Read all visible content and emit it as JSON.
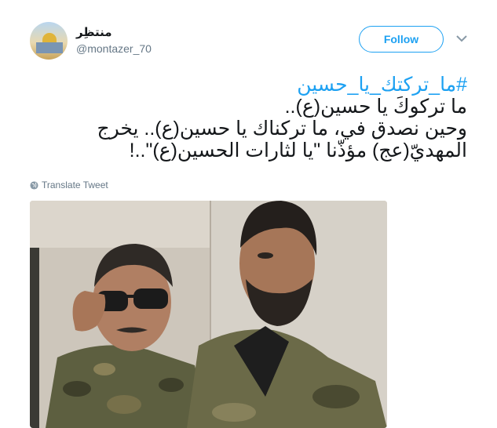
{
  "author": {
    "display_name": "منتظِر",
    "handle": "@montazer_70"
  },
  "follow_label": "Follow",
  "tweet": {
    "hashtag": "#ما_تركتك_يا_حسين",
    "line1": "ما تركوكَ يا حسين(ع)..",
    "line2": "وحين نصدق في، ما تركناك يا حسين(ع).. يخرج",
    "line3": "المهديّ(عج) مؤذّنا \"يا لثارات الحسين(ع)\"..!"
  },
  "translate_label": "Translate Tweet",
  "icons": {
    "caret": "chevron-down-icon",
    "globe": "globe-icon"
  },
  "colors": {
    "accent": "#1da1f2",
    "text": "#14171a",
    "muted": "#657786"
  }
}
